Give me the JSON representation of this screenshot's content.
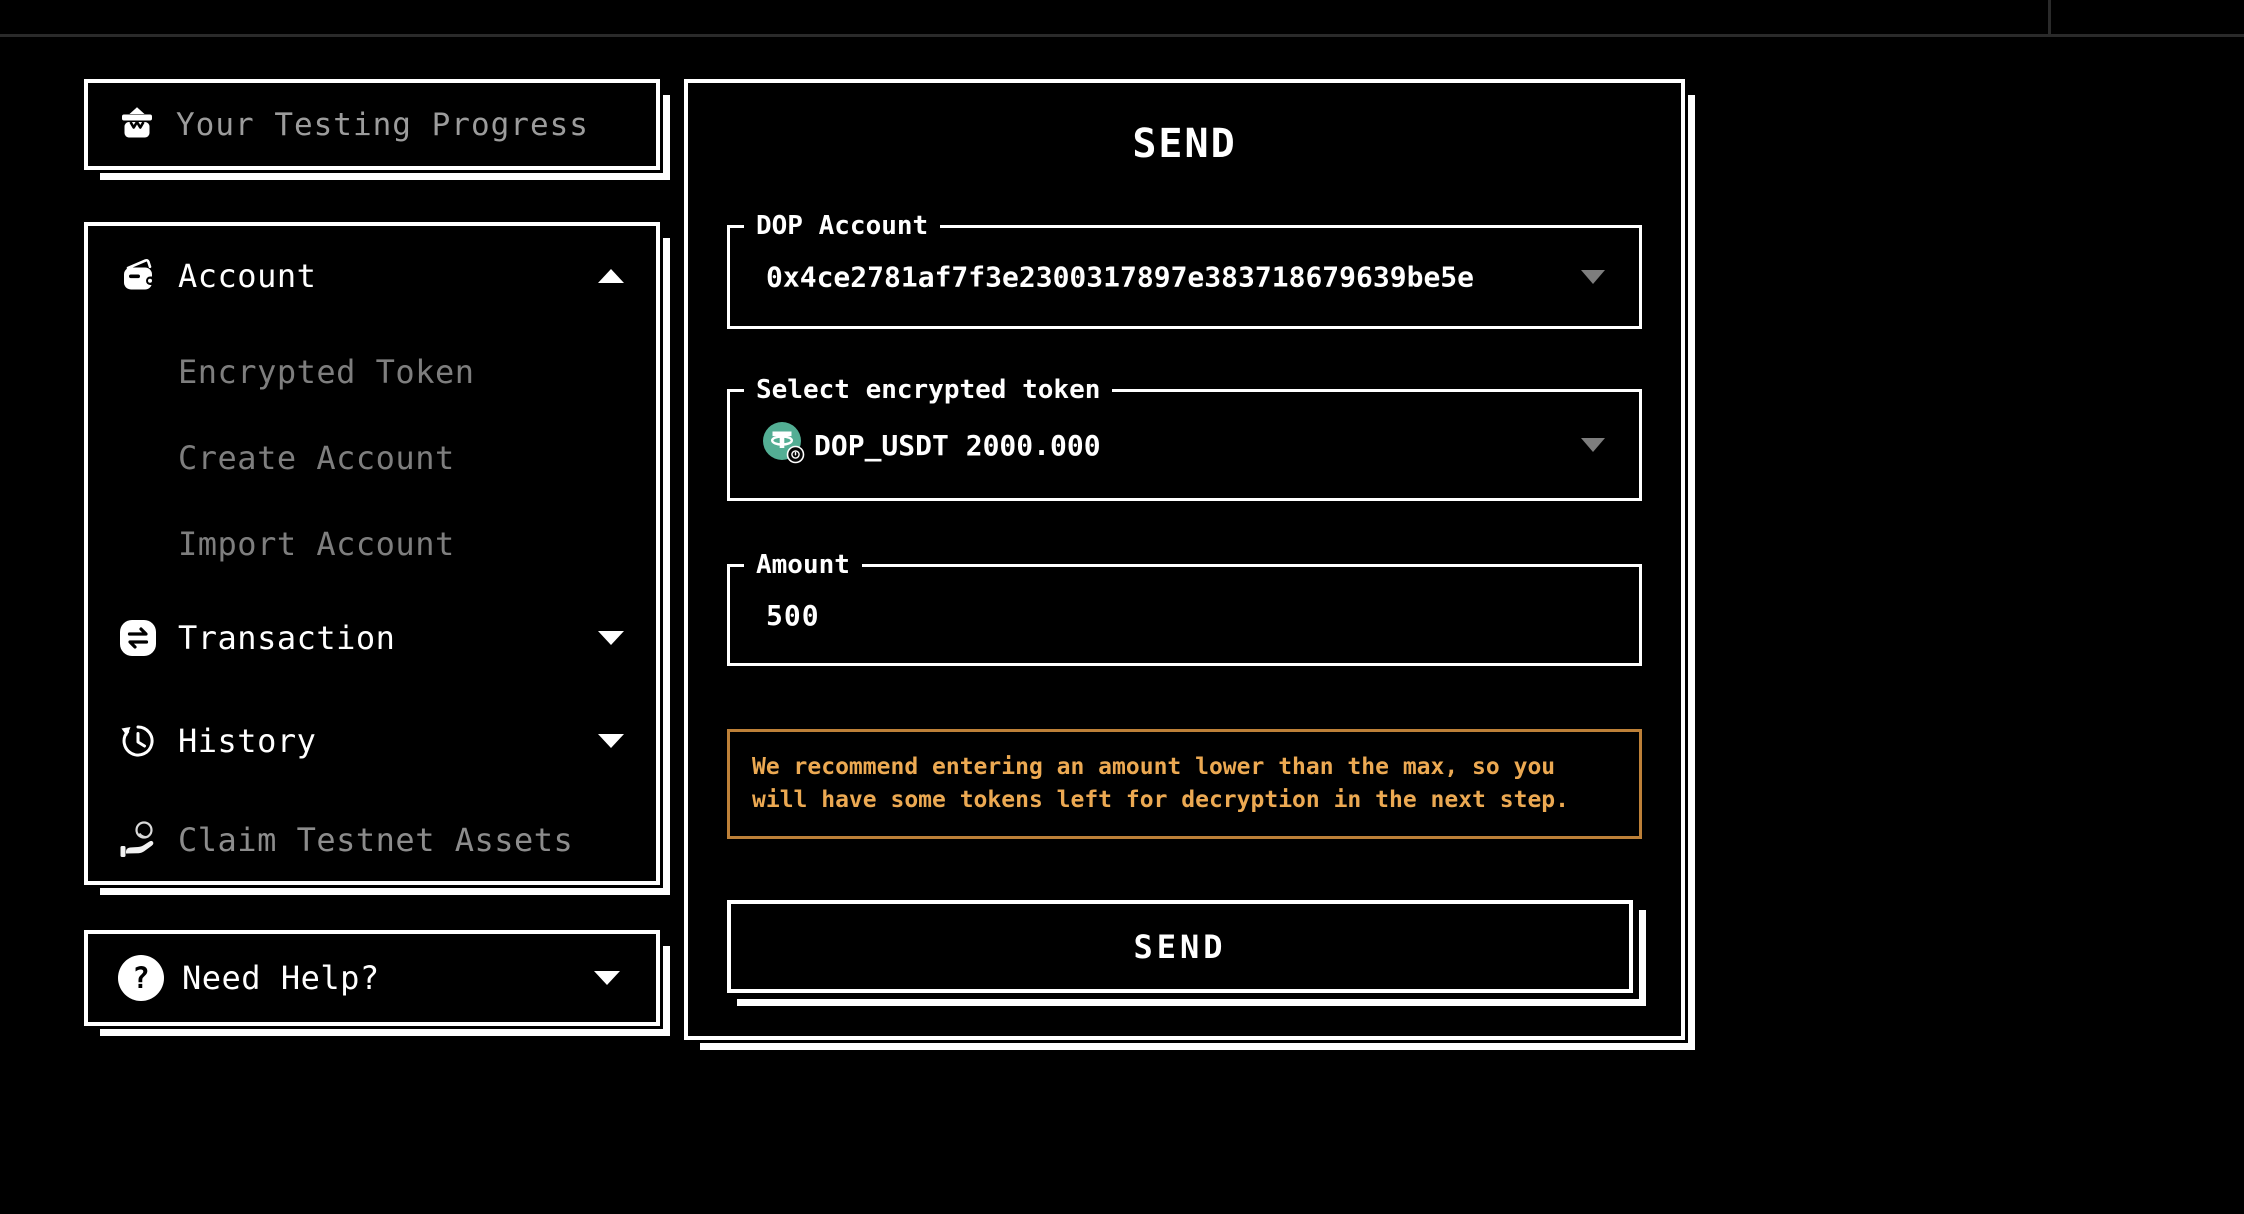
{
  "topbar": {},
  "sidebar": {
    "progress_card": {
      "label": "Your Testing Progress",
      "icon": "gift-icon"
    },
    "menu": {
      "account": {
        "label": "Account",
        "icon": "wallet-icon",
        "expanded": true,
        "children": [
          {
            "label": "Encrypted Token"
          },
          {
            "label": "Create Account"
          },
          {
            "label": "Import Account"
          }
        ]
      },
      "transaction": {
        "label": "Transaction",
        "icon": "swap-arrows-icon",
        "expanded": false
      },
      "history": {
        "label": "History",
        "icon": "history-clock-icon",
        "expanded": false
      },
      "claim": {
        "label": "Claim Testnet Assets",
        "icon": "hand-coin-icon"
      }
    },
    "help_card": {
      "label": "Need Help?",
      "icon": "question-circle-icon",
      "expanded": false
    }
  },
  "main": {
    "title": "SEND",
    "dop_account": {
      "label": "DOP Account",
      "value": "0x4ce2781af7f3e2300317897e383718679639be5e"
    },
    "token": {
      "label": "Select encrypted token",
      "value": "DOP_USDT 2000.000",
      "icon": "tether-token-icon"
    },
    "amount": {
      "label": "Amount",
      "value": "500"
    },
    "warning": "We recommend entering an amount lower than the max, so you will have some tokens left for decryption in the next step.",
    "send_button": "SEND"
  },
  "colors": {
    "background": "#000000",
    "card_border": "#ffffff",
    "muted_text": "#8c8c8c",
    "warning_text": "#ECA952",
    "warning_border": "#BD8038",
    "tether_teal": "#53AE94",
    "topbar_divider": "#2A2A2A",
    "field_caret": "#7D7D7D"
  }
}
